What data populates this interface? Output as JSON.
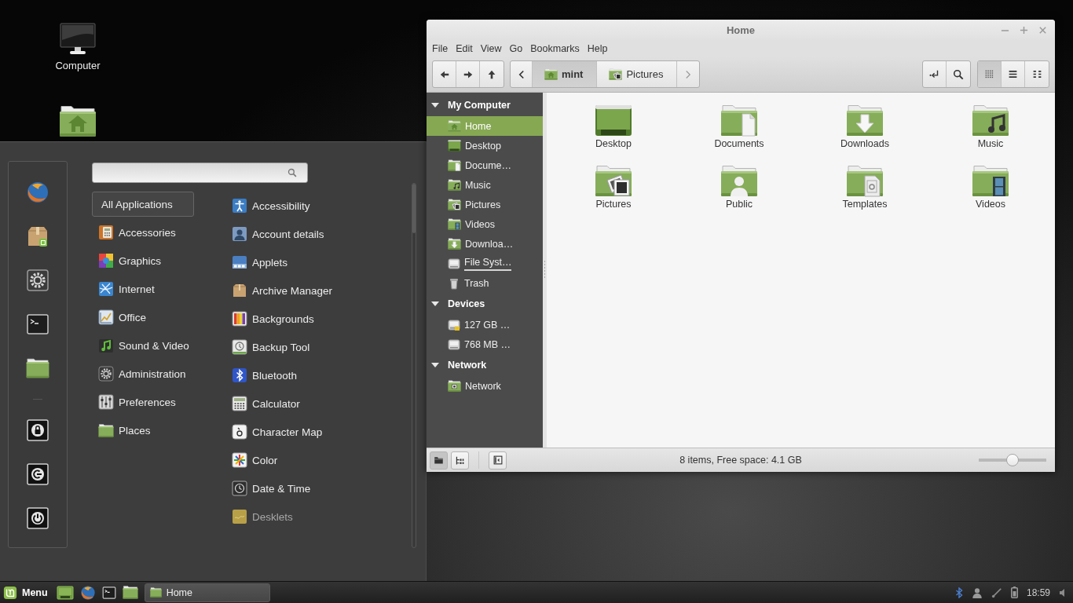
{
  "desktop": {
    "icons": [
      {
        "label": "Computer"
      }
    ]
  },
  "menu": {
    "categories": [
      {
        "label": "All Applications",
        "selected": true
      },
      {
        "label": "Accessories",
        "selected": false
      },
      {
        "label": "Graphics",
        "selected": false
      },
      {
        "label": "Internet",
        "selected": false
      },
      {
        "label": "Office",
        "selected": false
      },
      {
        "label": "Sound & Video",
        "selected": false
      },
      {
        "label": "Administration",
        "selected": false
      },
      {
        "label": "Preferences",
        "selected": false
      },
      {
        "label": "Places",
        "selected": false
      }
    ],
    "applications": [
      {
        "label": "Accessibility",
        "dimmed": false
      },
      {
        "label": "Account details",
        "dimmed": false
      },
      {
        "label": "Applets",
        "dimmed": false
      },
      {
        "label": "Archive Manager",
        "dimmed": false
      },
      {
        "label": "Backgrounds",
        "dimmed": false
      },
      {
        "label": "Backup Tool",
        "dimmed": false
      },
      {
        "label": "Bluetooth",
        "dimmed": false
      },
      {
        "label": "Calculator",
        "dimmed": false
      },
      {
        "label": "Character Map",
        "dimmed": false
      },
      {
        "label": "Color",
        "dimmed": false
      },
      {
        "label": "Date & Time",
        "dimmed": false
      },
      {
        "label": "Desklets",
        "dimmed": true
      }
    ]
  },
  "file_manager": {
    "window": {
      "title": "Home"
    },
    "menubar": [
      "File",
      "Edit",
      "View",
      "Go",
      "Bookmarks",
      "Help"
    ],
    "path_bar": [
      {
        "label": "mint",
        "selected": true
      },
      {
        "label": "Pictures",
        "selected": false
      }
    ],
    "view_modes": [
      {
        "selected": true
      },
      {
        "selected": false
      },
      {
        "selected": false
      }
    ],
    "sidebar": {
      "sections": [
        {
          "title": "My Computer",
          "expanded": true,
          "children": [
            {
              "label": "Home",
              "selected": true
            },
            {
              "label": "Desktop",
              "selected": false
            },
            {
              "label": "Docume…",
              "selected": false
            },
            {
              "label": "Music",
              "selected": false
            },
            {
              "label": "Pictures",
              "selected": false
            },
            {
              "label": "Videos",
              "selected": false
            },
            {
              "label": "Downloa…",
              "selected": false
            },
            {
              "label": "File Syst…",
              "selected": false,
              "level": 1
            },
            {
              "label": "Trash",
              "selected": false
            }
          ]
        },
        {
          "title": "Devices",
          "expanded": true,
          "children": [
            {
              "label": "127 GB …",
              "selected": false
            },
            {
              "label": "768 MB …",
              "selected": false
            }
          ]
        },
        {
          "title": "Network",
          "expanded": true,
          "children": [
            {
              "label": "Network",
              "selected": false
            }
          ]
        }
      ]
    },
    "files": [
      {
        "label": "Desktop"
      },
      {
        "label": "Documents"
      },
      {
        "label": "Downloads"
      },
      {
        "label": "Music"
      },
      {
        "label": "Pictures"
      },
      {
        "label": "Public"
      },
      {
        "label": "Templates"
      },
      {
        "label": "Videos"
      }
    ],
    "status_bar": {
      "panes": [
        {
          "selected": true
        },
        {
          "selected": false
        }
      ],
      "text": "8 items, Free space: 4.1 GB",
      "zoom": {
        "level": 0.5
      }
    }
  },
  "taskbar": {
    "menu_label": "Menu",
    "windows": [
      {
        "label": "Home"
      }
    ],
    "clock": "18:59"
  }
}
